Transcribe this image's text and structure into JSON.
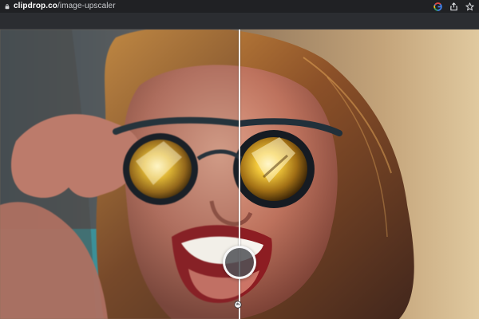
{
  "browser": {
    "url_domain": "clipdrop.co",
    "url_path": "/image-upscaler",
    "icons": [
      "lock-icon",
      "google-icon",
      "share-icon",
      "star-icon"
    ]
  },
  "viewer": {
    "comparison": "before-after-slider"
  },
  "colors": {
    "browser_bg": "#202124",
    "toolbar_bg": "#2b2d31",
    "divider": "#ffffff",
    "handle_bg": "#505256"
  }
}
